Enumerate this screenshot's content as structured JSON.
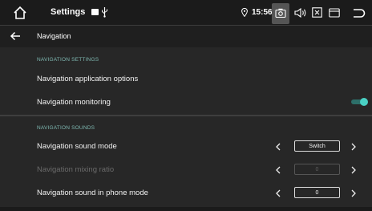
{
  "statusbar": {
    "title": "Settings",
    "time": "15:56"
  },
  "page": {
    "title": "Navigation"
  },
  "sections": {
    "settings": {
      "header": "NAVIGATION SETTINGS",
      "app_options_label": "Navigation application options",
      "monitoring_label": "Navigation monitoring",
      "monitoring_on": true
    },
    "sounds": {
      "header": "NAVIGATION SOUNDS",
      "sound_mode_label": "Navigation sound mode",
      "sound_mode_value": "Switch",
      "mixing_ratio_label": "Navigation mixing ratio",
      "mixing_ratio_value": "0",
      "phone_mode_label": "Navigation sound in phone mode",
      "phone_mode_value": "0"
    }
  },
  "colors": {
    "accent": "#4ad1c4",
    "section_header": "#7fb9b2",
    "background": "#272727"
  },
  "icons": {
    "home": "home-icon",
    "sd": "sd-card-icon",
    "usb": "usb-icon",
    "location": "location-pin-icon",
    "camera": "screenshot-icon",
    "volume": "volume-icon",
    "close": "close-box-icon",
    "window": "window-icon",
    "back": "back-icon"
  }
}
